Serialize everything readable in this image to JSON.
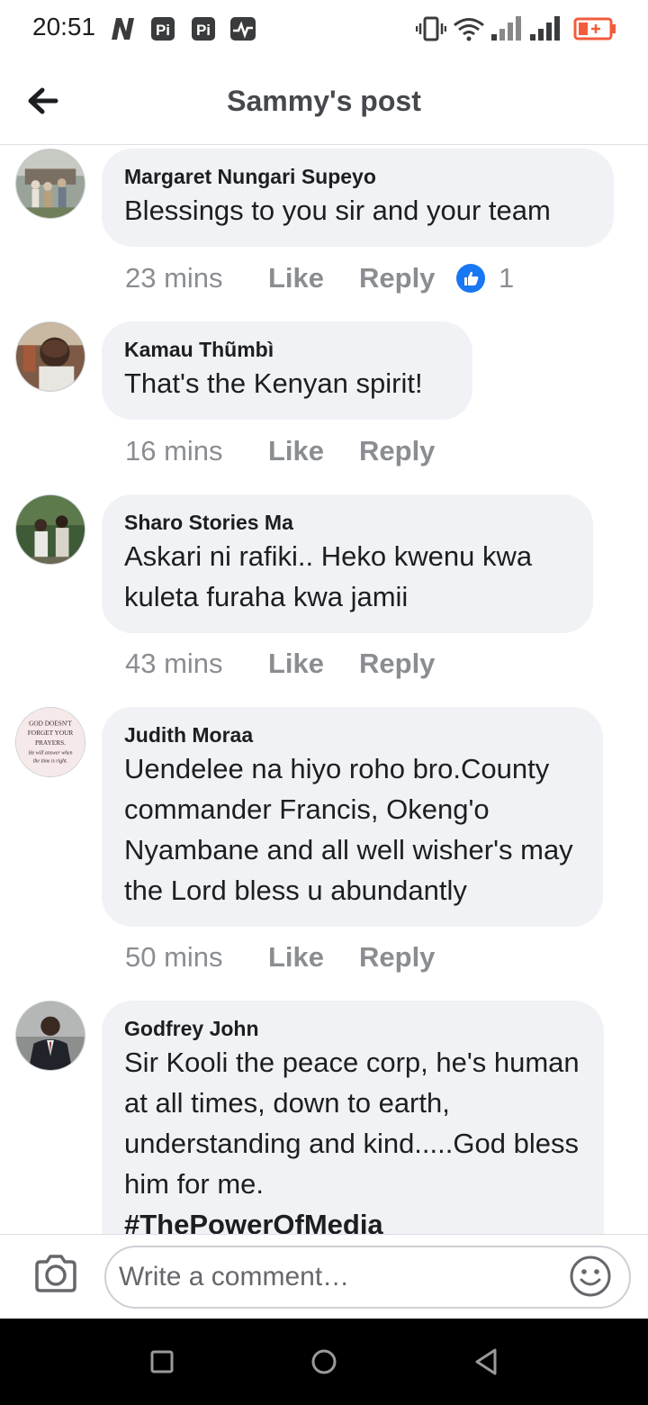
{
  "status_bar": {
    "time": "20:51"
  },
  "header": {
    "title": "Sammy's post"
  },
  "comments": [
    {
      "author": "Margaret Nungari Supeyo",
      "text": "Blessings to you sir and your team",
      "time": "23 mins",
      "like": "Like",
      "reply": "Reply",
      "reaction_count": "1"
    },
    {
      "author": "Kamau Thũmbì",
      "text": "That's the Kenyan spirit!",
      "time": "16 mins",
      "like": "Like",
      "reply": "Reply"
    },
    {
      "author": "Sharo Stories Ma",
      "text": "Askari ni rafiki.. Heko kwenu kwa kuleta furaha kwa jamii",
      "time": "43 mins",
      "like": "Like",
      "reply": "Reply"
    },
    {
      "author": "Judith Moraa",
      "text": "Uendelee na hiyo roho bro.County commander Francis, Okeng'o Nyambane and all well wisher's may the Lord bless u abundantly",
      "time": "50 mins",
      "like": "Like",
      "reply": "Reply",
      "avatar_text": "GOD DOESN'T FORGET YOUR PRAYERS. He will answer when the time is right."
    },
    {
      "author": "Godfrey John",
      "text": "Sir Kooli the peace corp, he's human at all times, down to earth, understanding and kind.....God bless him for me.",
      "hashtag": "#ThePowerOfMedia"
    }
  ],
  "composer": {
    "placeholder": "Write a comment…"
  },
  "colors": {
    "bubble": "#f0f2f5",
    "meta": "#8a8d91",
    "like_blue": "#1877f2"
  }
}
